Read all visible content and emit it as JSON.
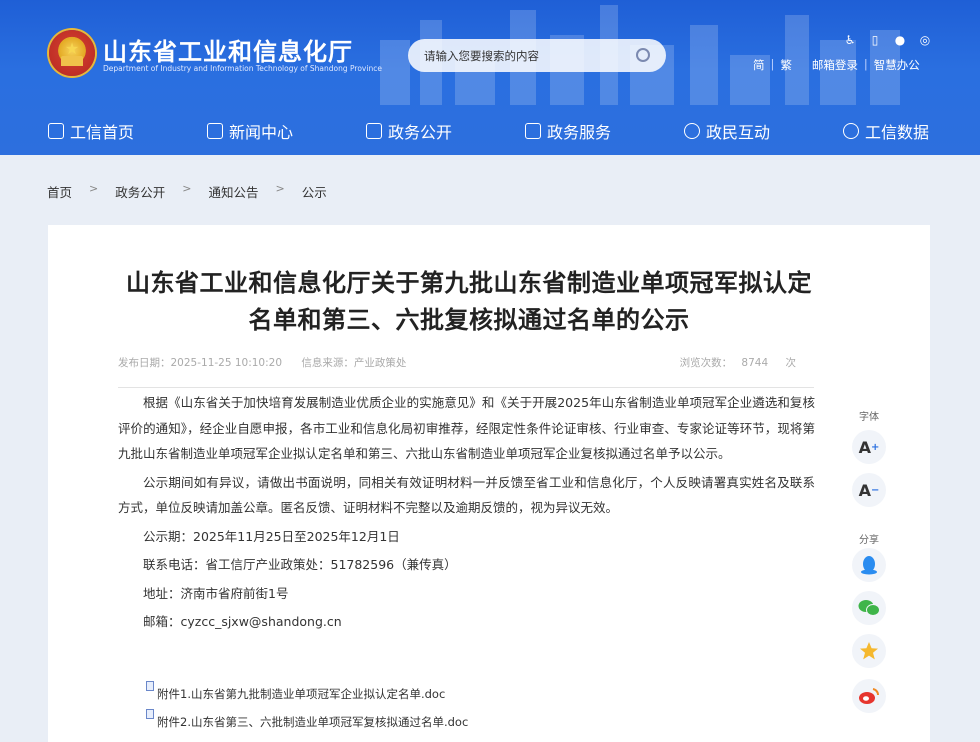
{
  "header": {
    "site_title": "山东省工业和信息化厅",
    "site_subtitle": "Department of Industry and Information Technology of Shandong Province",
    "search_placeholder": "请输入您要搜索的内容",
    "top_icons": [
      "accessibility-icon",
      "mobile-icon",
      "wechat-icon",
      "weibo-icon"
    ],
    "lang_simplified": "简",
    "lang_traditional": "繁",
    "mail_login": "邮箱登录",
    "smart_office": "智慧办公",
    "accent_color": "#2a6fe0"
  },
  "nav": {
    "items": [
      {
        "label": "工信首页",
        "icon": "home-icon"
      },
      {
        "label": "新闻中心",
        "icon": "news-icon"
      },
      {
        "label": "政务公开",
        "icon": "monitor-icon"
      },
      {
        "label": "政务服务",
        "icon": "service-icon"
      },
      {
        "label": "政民互动",
        "icon": "chat-icon"
      },
      {
        "label": "工信数据",
        "icon": "database-icon"
      }
    ]
  },
  "breadcrumb": {
    "items": [
      "首页",
      "政务公开",
      "通知公告",
      "公示"
    ],
    "separator": ">"
  },
  "article": {
    "title": "山东省工业和信息化厅关于第九批山东省制造业单项冠军拟认定名单和第三、六批复核拟通过名单的公示",
    "publish_label": "发布日期：2025-11-25 10:10:20",
    "source_label": "信息来源：产业政策处",
    "views_label": "浏览次数：",
    "views": "8744",
    "views_unit": "次",
    "paragraphs": [
      "根据《山东省关于加快培育发展制造业优质企业的实施意见》和《关于开展2025年山东省制造业单项冠军企业遴选和复核评价的通知》，经企业自愿申报，各市工业和信息化局初审推荐，经限定性条件论证审核、行业审查、专家论证等环节，现将第九批山东省制造业单项冠军企业拟认定名单和第三、六批山东省制造业单项冠军企业复核拟通过名单予以公示。",
      "公示期间如有异议，请做出书面说明，同相关有效证明材料一并反馈至省工业和信息化厅，个人反映请署真实姓名及联系方式，单位反映请加盖公章。匿名反馈、证明材料不完整以及逾期反馈的，视为异议无效。"
    ],
    "period": "公示期：2025年11月25日至2025年12月1日",
    "phone": "联系电话：省工信厅产业政策处：51782596（兼传真）",
    "address": "地址：济南市省府前街1号",
    "email": "邮箱：cyzcc_sjxw@shandong.cn",
    "attachments": [
      "附件1.山东省第九批制造业单项冠军企业拟认定名单.doc",
      "附件2.山东省第三、六批制造业单项冠军复核拟通过名单.doc"
    ]
  },
  "side_tools": {
    "font_label": "字体",
    "font_increase": "A",
    "font_decrease": "A",
    "share_label": "分享",
    "share_icons": [
      "qq-icon",
      "wechat-share-icon",
      "qzone-icon",
      "weibo-share-icon"
    ]
  }
}
